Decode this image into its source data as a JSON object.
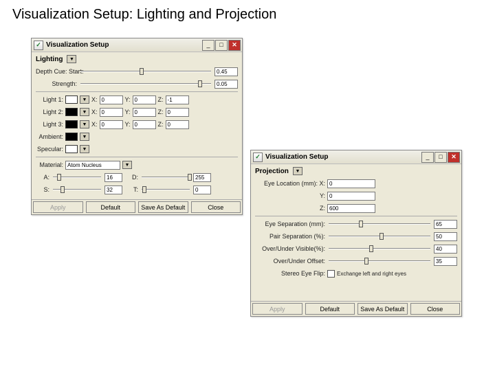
{
  "page_title": "Visualization Setup: Lighting and Projection",
  "win1": {
    "title": "Visualization Setup",
    "section": "Lighting",
    "depth_label": "Depth Cue:",
    "depth_start_label": "Start:",
    "depth_start_value": "0.45",
    "strength_label": "Strength:",
    "strength_value": "0.05",
    "light1_label": "Light 1:",
    "light2_label": "Light 2:",
    "light3_label": "Light 3:",
    "x": "X:",
    "y": "Y:",
    "z": "Z:",
    "l1x": "0",
    "l1y": "0",
    "l1z": "-1",
    "l2x": "0",
    "l2y": "0",
    "l2z": "0",
    "l3x": "0",
    "l3y": "0",
    "l3z": "0",
    "ambient_label": "Ambient:",
    "specular_label": "Specular:",
    "material_label": "Material:",
    "material_value": "Atom Nucleus",
    "a_label": "A:",
    "a_val": "16",
    "d_label": "D:",
    "d_val": "255",
    "s_label": "S:",
    "s_val": "32",
    "t_label": "T:",
    "t_val": "0",
    "apply": "Apply",
    "default": "Default",
    "saveas": "Save As Default",
    "close": "Close"
  },
  "win2": {
    "title": "Visualization Setup",
    "section": "Projection",
    "eye_loc_label": "Eye Location (mm):",
    "x": "X:",
    "y": "Y:",
    "z": "Z:",
    "ex": "0",
    "ey": "0",
    "ez": "600",
    "sep_label": "Eye Separation (mm):",
    "sep_val": "65",
    "pair_label": "Pair Separation (%):",
    "pair_val": "50",
    "ouv_label": "Over/Under Visible(%):",
    "ouv_val": "40",
    "ouo_label": "Over/Under Offset:",
    "ouo_val": "35",
    "flip_label": "Stereo Eye Flip:",
    "flip_desc": "Exchange left and right eyes",
    "apply": "Apply",
    "default": "Default",
    "saveas": "Save As Default",
    "close": "Close"
  }
}
